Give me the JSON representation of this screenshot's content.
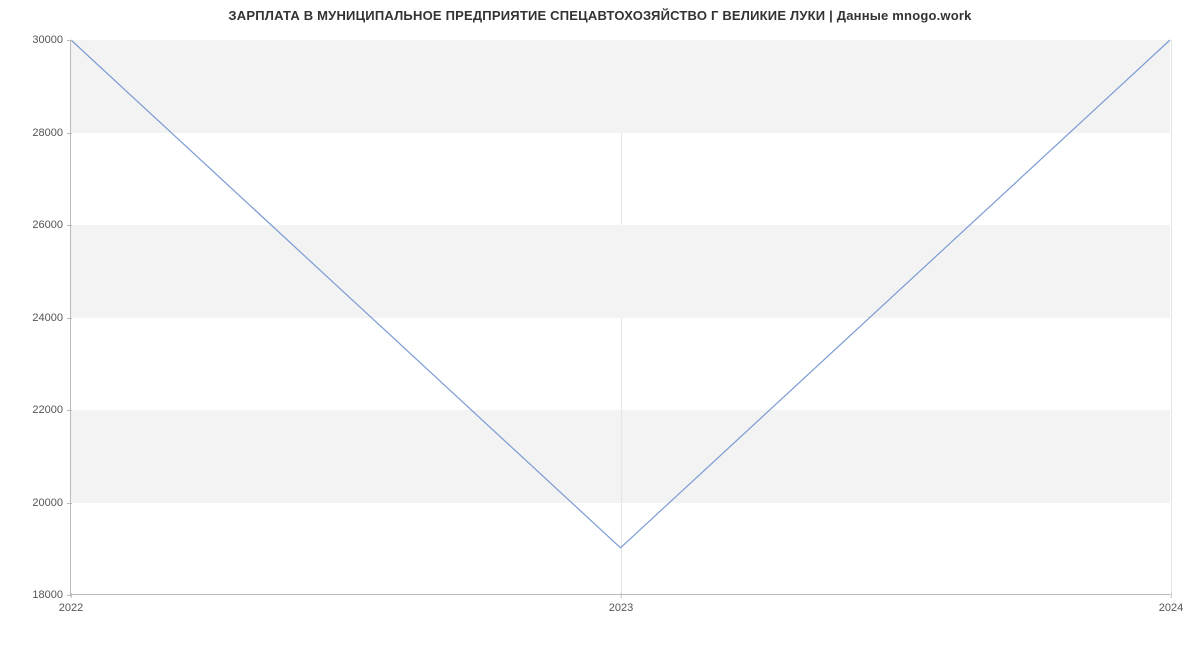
{
  "chart_data": {
    "type": "line",
    "title": "ЗАРПЛАТА В МУНИЦИПАЛЬНОЕ ПРЕДПРИЯТИЕ СПЕЦАВТОХОЗЯЙСТВО Г ВЕЛИКИЕ ЛУКИ | Данные mnogo.work",
    "xlabel": "",
    "ylabel": "",
    "x": [
      2022,
      2023,
      2024
    ],
    "values": [
      30000,
      19000,
      30000
    ],
    "x_ticks": [
      2022,
      2023,
      2024
    ],
    "y_ticks": [
      18000,
      20000,
      22000,
      24000,
      26000,
      28000,
      30000
    ],
    "xlim": [
      2022,
      2024
    ],
    "ylim": [
      18000,
      30000
    ],
    "line_color": "#7a9bd4",
    "band_color": "#f3f3f3"
  }
}
